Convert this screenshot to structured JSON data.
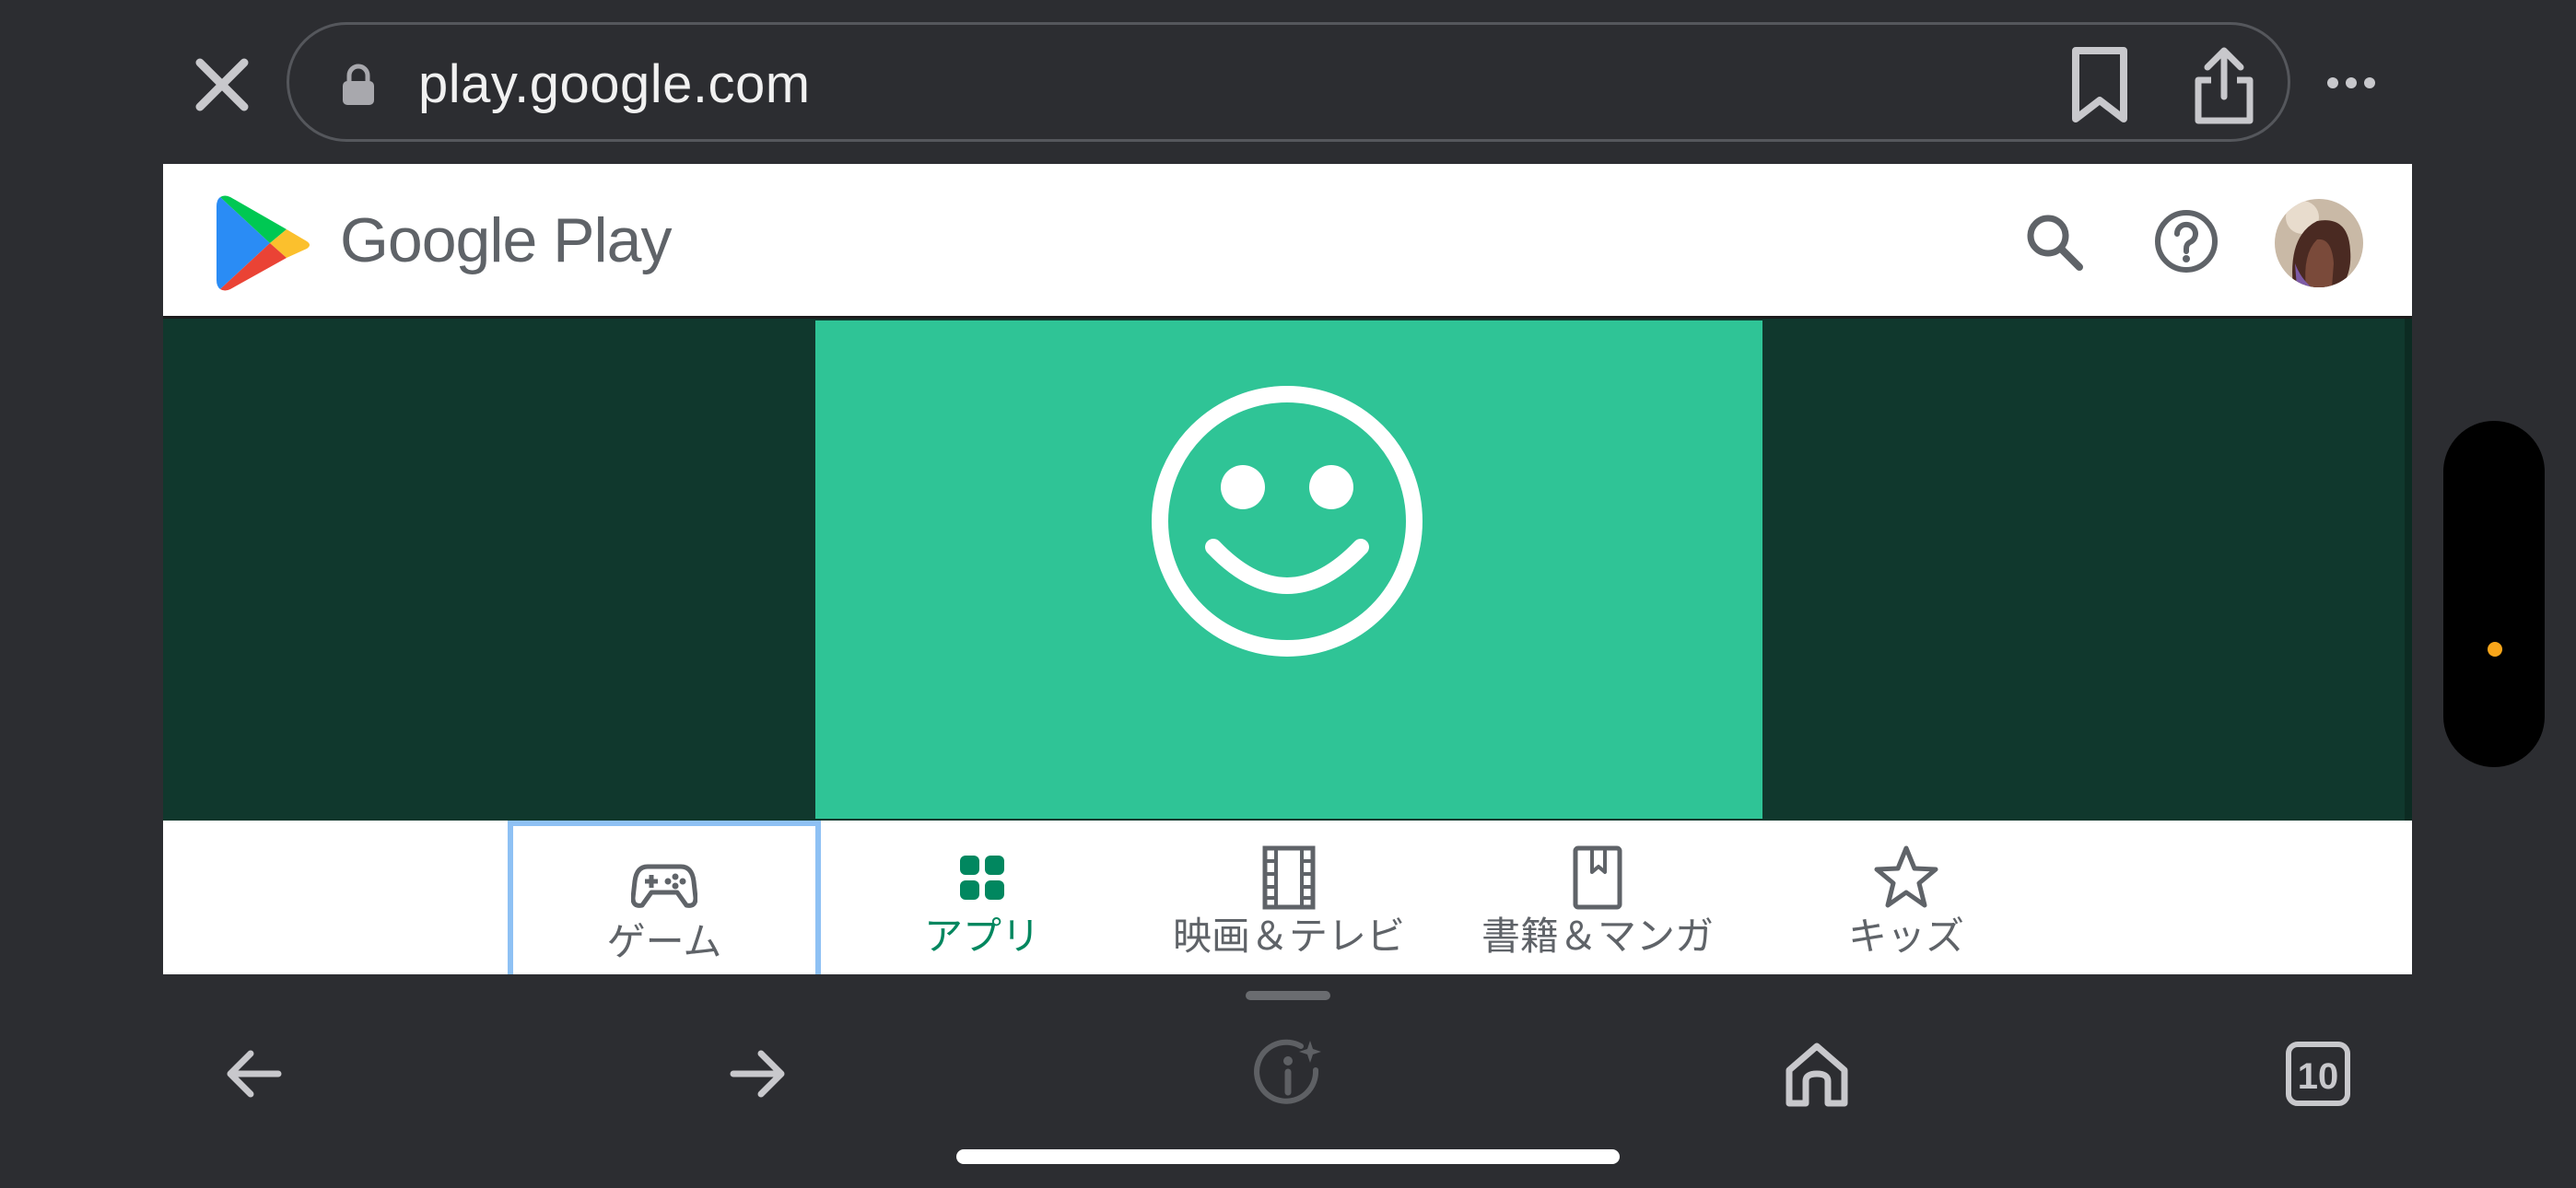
{
  "browser": {
    "url": "play.google.com",
    "icons": {
      "close": "close-icon",
      "lock": "lock-icon",
      "bookmark": "bookmark-icon",
      "share": "share-icon",
      "more": "more-horizontal-icon"
    }
  },
  "header": {
    "brand": "Google Play",
    "icons": {
      "search": "search-icon",
      "help": "help-icon",
      "avatar": "avatar"
    }
  },
  "banner": {
    "icon": "smiley-icon",
    "colors": {
      "background": "#10382d",
      "center": "#2fc496"
    }
  },
  "categories": [
    {
      "label": "ゲーム",
      "icon": "gamepad-icon",
      "focused": true,
      "active": false
    },
    {
      "label": "アプリ",
      "icon": "apps-grid-icon",
      "focused": false,
      "active": true
    },
    {
      "label": "映画＆テレビ",
      "icon": "film-icon",
      "focused": false,
      "active": false
    },
    {
      "label": "書籍＆マンガ",
      "icon": "book-icon",
      "focused": false,
      "active": false
    },
    {
      "label": "キッズ",
      "icon": "star-icon",
      "focused": false,
      "active": false
    }
  ],
  "toolbar": {
    "icons": {
      "back": "back-arrow-icon",
      "forward": "forward-arrow-icon",
      "info": "info-sparkle-icon",
      "home": "home-icon",
      "tabs": "tabs-icon"
    },
    "tab_count": "10"
  },
  "colors": {
    "accent": "#01875f",
    "focus_ring": "#8ec1f4",
    "chrome": "#2c2d31",
    "side_dot": "#f7a51a"
  }
}
